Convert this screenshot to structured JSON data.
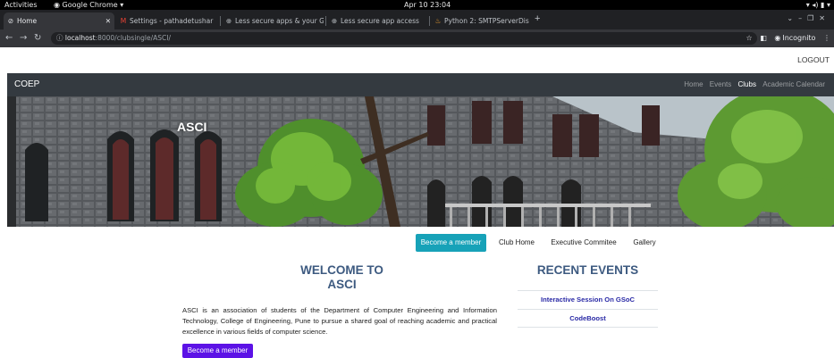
{
  "os_bar": {
    "activities": "Activities",
    "app_menu": "Google Chrome ▾",
    "clock": "Apr 10  23:04",
    "tray_icons": [
      "wifi-icon",
      "volume-icon",
      "battery-icon",
      "power-menu-icon"
    ]
  },
  "browser": {
    "tabs": [
      {
        "title": "Home",
        "favicon": "globe-icon",
        "active": true
      },
      {
        "title": "Settings - pathadetushar",
        "favicon": "gmail-icon",
        "active": false
      },
      {
        "title": "Less secure apps & your G",
        "favicon": "google-icon",
        "active": false
      },
      {
        "title": "Less secure app access",
        "favicon": "google-icon",
        "active": false
      },
      {
        "title": "Python 2: SMTPServerDis",
        "favicon": "python-icon",
        "active": false
      }
    ],
    "url_host": "localhost",
    "url_path": ":8000/clubsingle/ASCI/",
    "incognito_label": "Incognito"
  },
  "page": {
    "logout": "LOGOUT",
    "brand": "COEP",
    "nav": [
      {
        "label": "Home",
        "active": false
      },
      {
        "label": "Events",
        "active": false
      },
      {
        "label": "Clubs",
        "active": true
      },
      {
        "label": "Academic Calendar",
        "active": false
      }
    ],
    "hero_title": "ASCI",
    "club_tabs": [
      {
        "label": "Become a member",
        "primary": true
      },
      {
        "label": "Club Home",
        "primary": false
      },
      {
        "label": "Executive Commitee",
        "primary": false
      },
      {
        "label": "Gallery",
        "primary": false
      }
    ],
    "welcome_line1": "WELCOME TO",
    "welcome_line2": "ASCI",
    "about": "ASCI is an association of students of the Department of Computer Engineering and Information Technology, College of Engineering, Pune to pursue a shared goal of reaching academic and practical excellence in various fields of computer science.",
    "member_button": "Become a member",
    "recent_title": "RECENT EVENTS",
    "events": [
      "Interactive Session On GSoC",
      "CodeBoost"
    ]
  },
  "colors": {
    "navbar": "#343a40",
    "primary_tab": "#17a2b8",
    "member_button": "#5c12e6",
    "heading": "#3d5a80",
    "event_link": "#2a2aa6"
  }
}
